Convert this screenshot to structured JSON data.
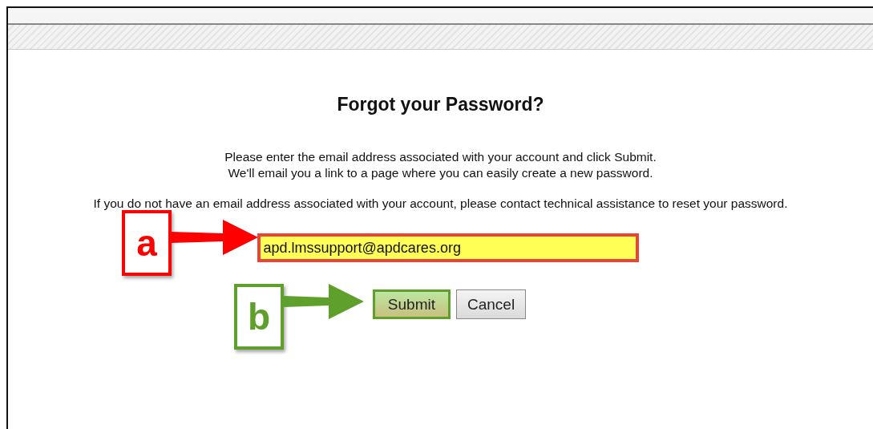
{
  "heading": "Forgot your Password?",
  "instructions": [
    "Please enter the email address associated with your account and click Submit.",
    "We'll email you a link to a page where you can easily create a new password."
  ],
  "note": "If you do not have an email address associated with your account, please contact technical assistance to reset your password.",
  "email_field": {
    "value": "apd.lmssupport@apdcares.org",
    "highlighted": true
  },
  "buttons": [
    {
      "label": "Submit",
      "kind": "primary",
      "highlighted": true
    },
    {
      "label": "Cancel",
      "kind": "secondary",
      "highlighted": false
    }
  ],
  "callouts": [
    {
      "label": "a",
      "color": "#ff0000",
      "kind": "field"
    },
    {
      "label": "b",
      "color": "#5ea02b",
      "kind": "button"
    }
  ]
}
